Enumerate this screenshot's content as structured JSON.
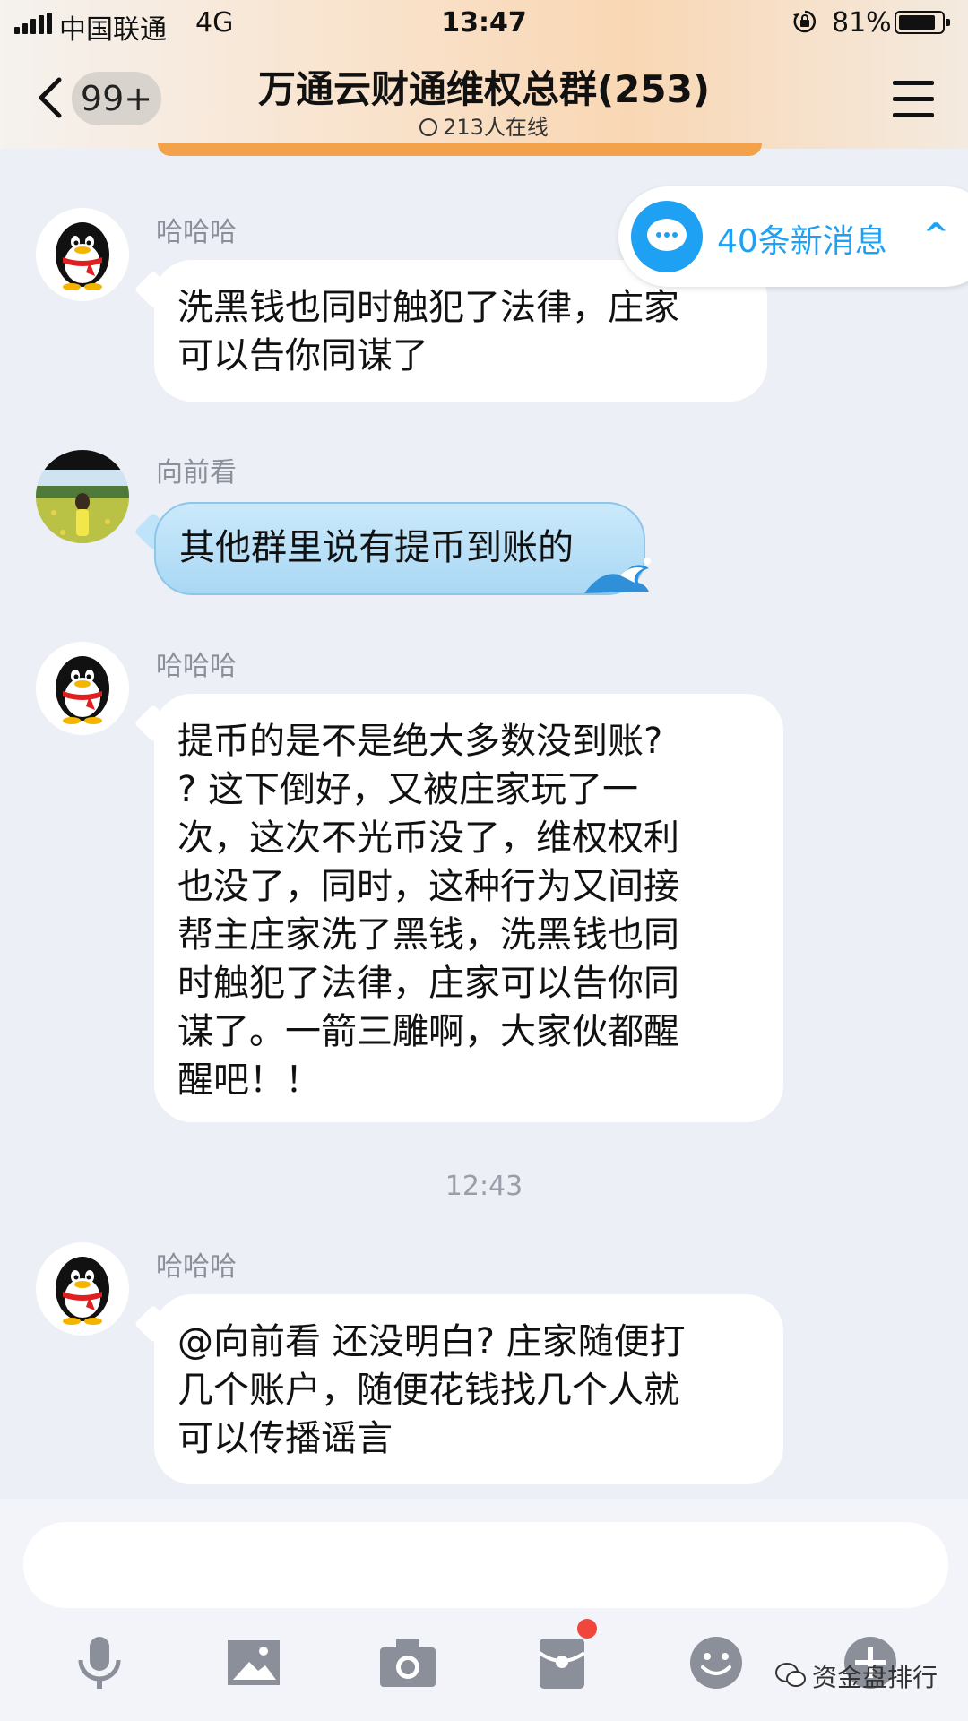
{
  "status_bar": {
    "carrier": "中国联通",
    "network": "4G",
    "time": "13:47",
    "battery": "81%"
  },
  "header": {
    "unread_badge": "99+",
    "title": "万通云财通维权总群(253)",
    "online": "213人在线"
  },
  "new_messages": {
    "label": "40条新消息"
  },
  "messages": [
    {
      "sender": "哈哈哈",
      "lines": [
        "洗黑钱也同时触犯了法律，庄家",
        "可以告你同谋了"
      ]
    },
    {
      "sender": "向前看",
      "lines": [
        "其他群里说有提币到账的"
      ]
    },
    {
      "sender": "哈哈哈",
      "lines": [
        "提币的是不是绝大多数没到账?",
        "? 这下倒好，又被庄家玩了一",
        "次，这次不光币没了，维权权利",
        "也没了，同时，这种行为又间接",
        "帮主庄家洗了黑钱，洗黑钱也同",
        "时触犯了法律，庄家可以告你同",
        "谋了。一箭三雕啊，大家伙都醒",
        "醒吧！！"
      ]
    },
    {
      "sender": "哈哈哈",
      "lines": [
        "@向前看 还没明白? 庄家随便打",
        "几个账户，随便花钱找几个人就",
        "可以传播谣言"
      ]
    }
  ],
  "timestamp": "12:43",
  "watermark": "资金盘排行",
  "colors": {
    "accent_blue": "#1ea1f2",
    "notification_red": "#f0463b",
    "header_gradient_mid": "#f9d7b4"
  },
  "icons": [
    "back-icon",
    "menu-icon",
    "new-message-icon",
    "voice-icon",
    "image-icon",
    "camera-icon",
    "red-packet-icon",
    "emoji-icon",
    "plus-icon",
    "wechat-icon"
  ]
}
